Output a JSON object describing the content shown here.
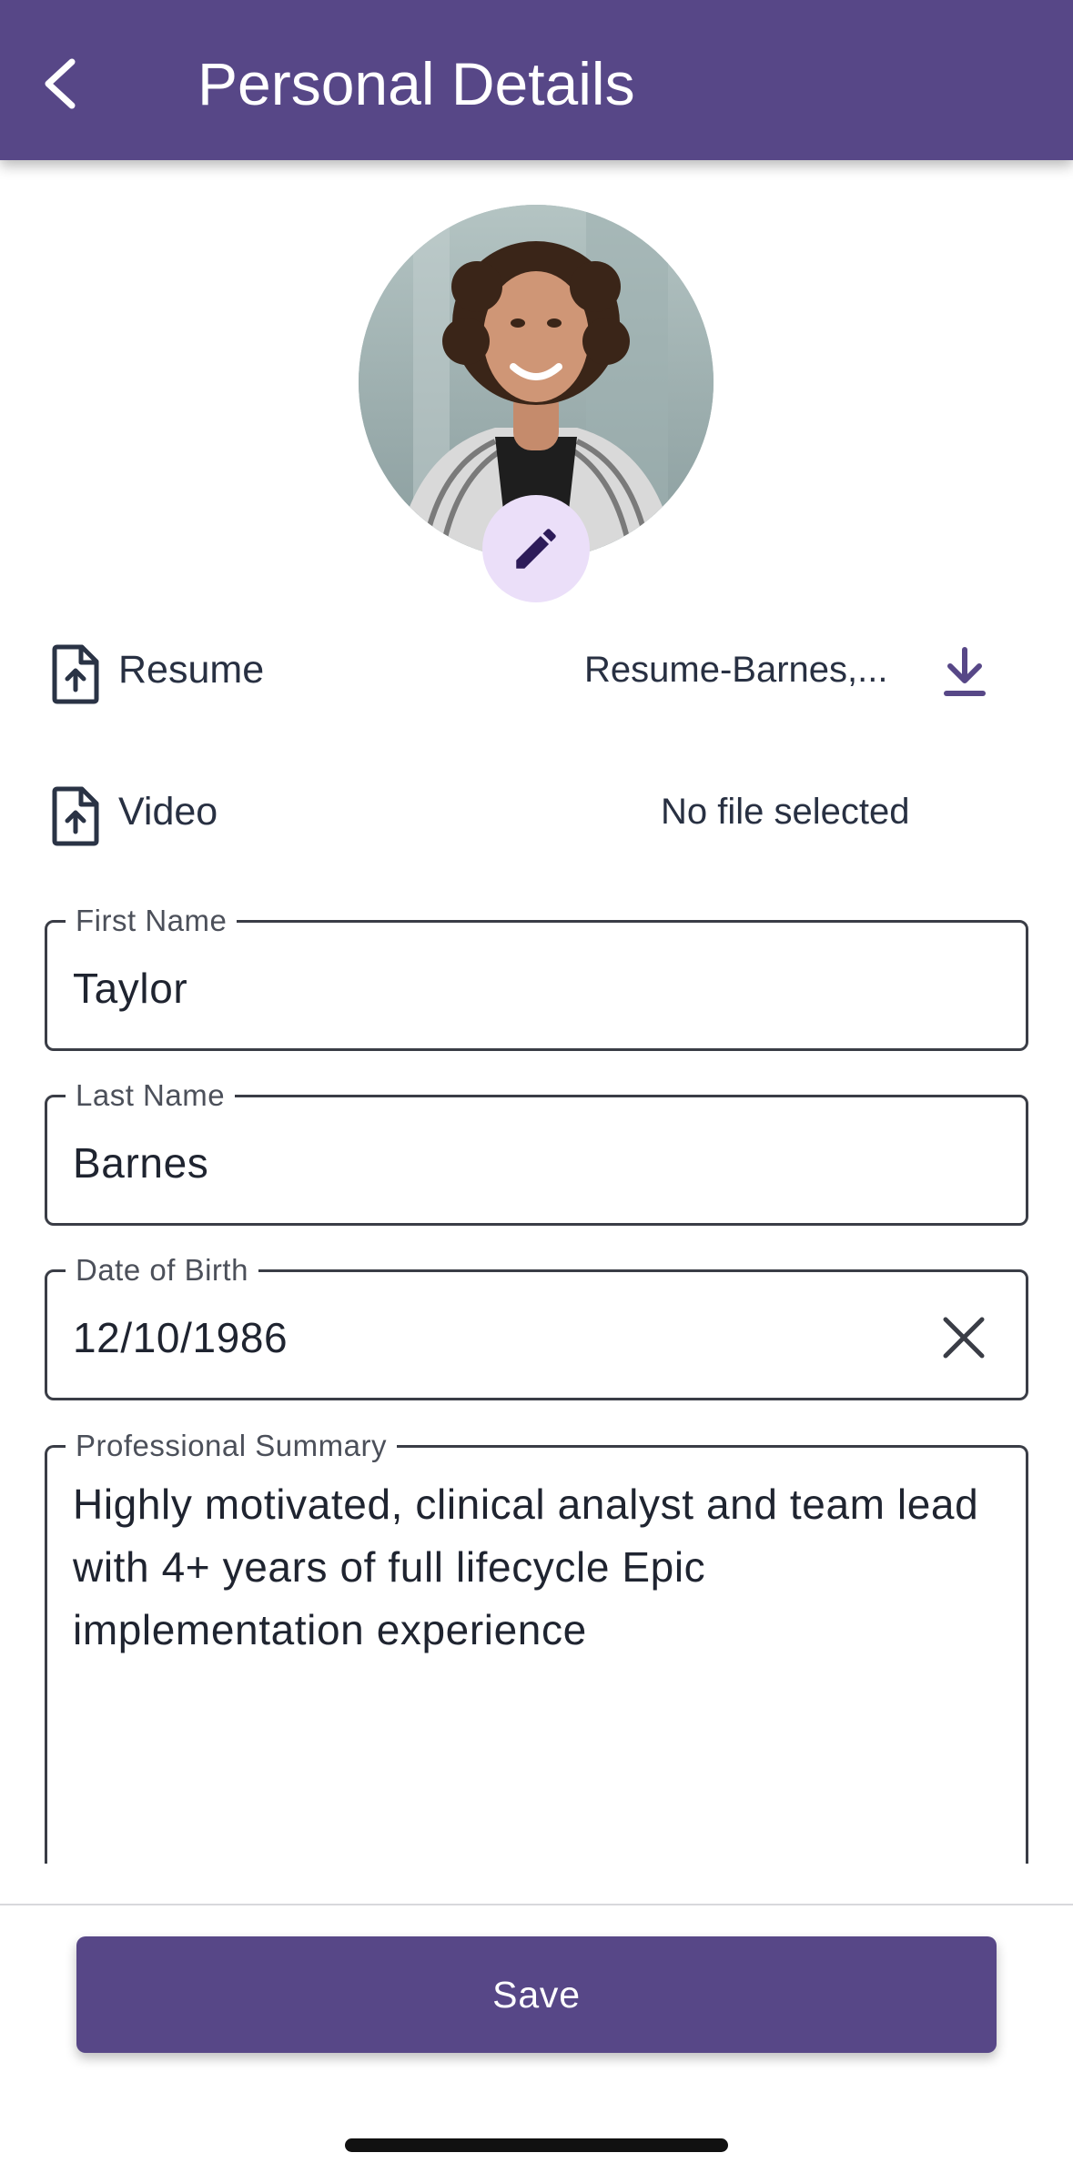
{
  "header": {
    "title": "Personal Details"
  },
  "icons": {
    "back": "chevron-left-icon",
    "edit_photo": "pencil-icon",
    "file_upload": "file-upload-icon",
    "download": "download-icon",
    "clear": "close-icon"
  },
  "profile_photo": {
    "alt": "Profile photo"
  },
  "files": {
    "resume": {
      "label": "Resume",
      "value": "Resume-Barnes,..."
    },
    "video": {
      "label": "Video",
      "value": "No file selected"
    }
  },
  "form": {
    "first_name": {
      "label": "First Name",
      "value": "Taylor"
    },
    "last_name": {
      "label": "Last Name",
      "value": "Barnes"
    },
    "date_of_birth": {
      "label": "Date of Birth",
      "value": "12/10/1986"
    },
    "professional_summary": {
      "label": "Professional Summary",
      "value": "Highly motivated, clinical analyst and team lead with 4+ years of full lifecycle Epic implementation experience"
    }
  },
  "actions": {
    "save_label": "Save"
  },
  "colors": {
    "primary": "#574787",
    "edit_badge_bg": "#ebdff9",
    "edit_icon": "#2d1b59",
    "text": "#1f2430",
    "field_border": "#3a3d46"
  }
}
